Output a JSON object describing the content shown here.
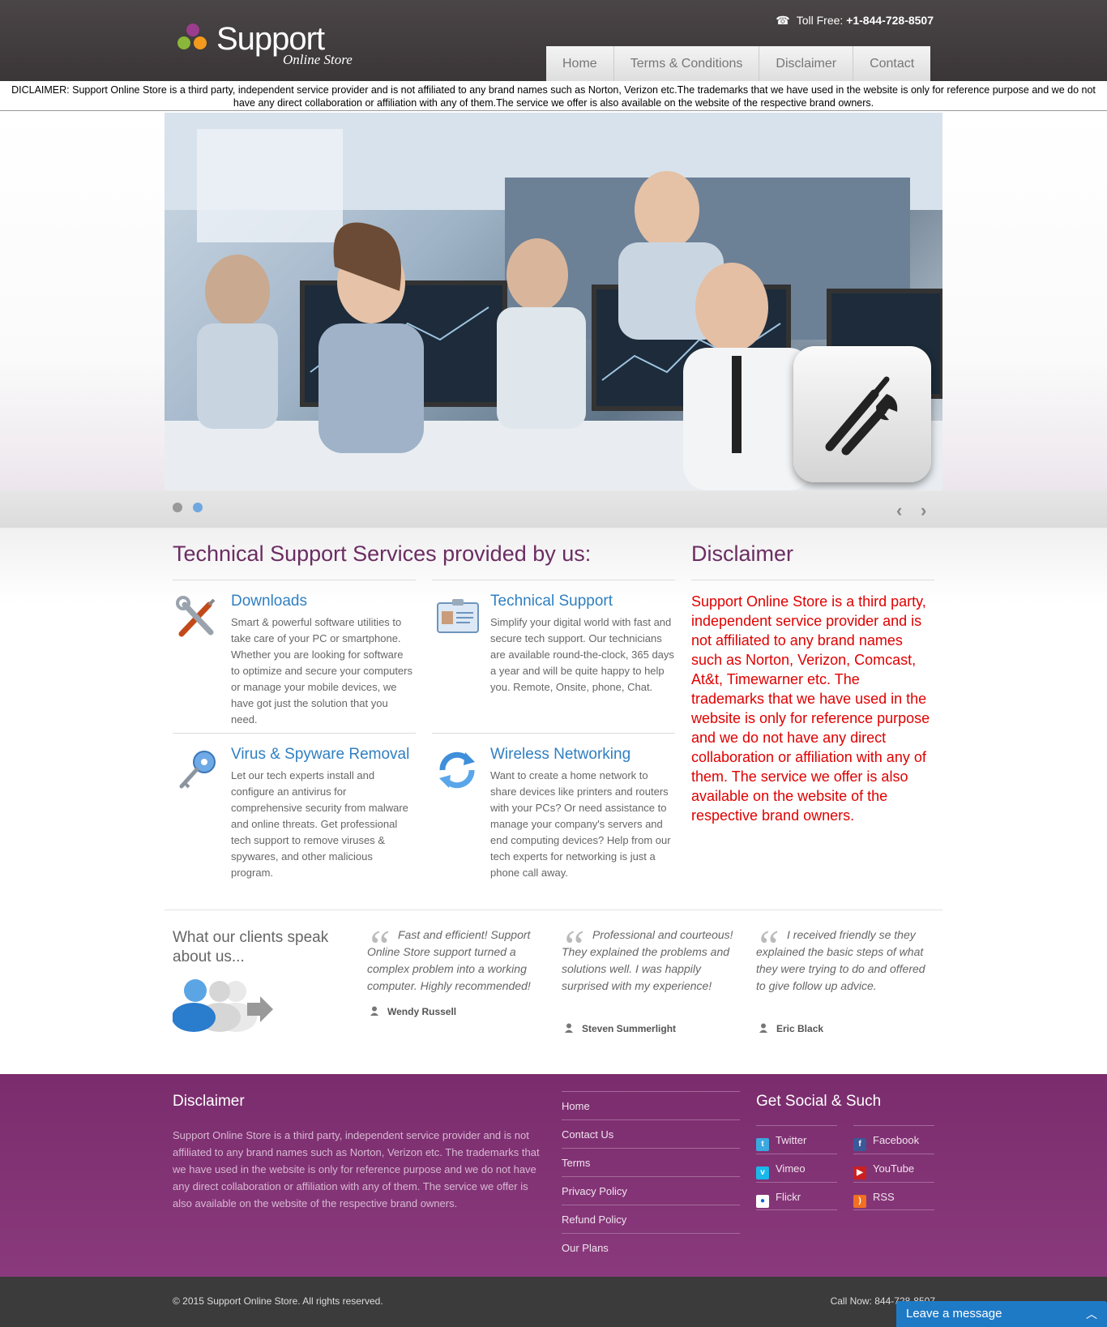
{
  "header": {
    "brand": "Support",
    "brand_sub": "Online Store",
    "toll_label": "Toll Free: ",
    "toll_number": "+1-844-728-8507",
    "nav": [
      "Home",
      "Terms & Conditions",
      "Disclaimer",
      "Contact"
    ]
  },
  "disclaimer_bar": "DICLAIMER: Support Online Store is a third party, independent service provider and is not affiliated to any brand names such as Norton, Verizon etc.The trademarks that we have used in the website is only for reference purpose and we do not have any direct collaboration or affiliation with any of them.The service we offer is also available on the website of the respective brand owners.",
  "slider": {
    "prev": "‹",
    "next": "›"
  },
  "services": {
    "title": "Technical Support Services provided by us:",
    "items": [
      {
        "title": "Downloads",
        "text": "Smart & powerful software utilities to take care of your PC or smartphone. Whether you are looking for software to optimize and secure your computers or manage your mobile devices, we have got just the solution that you need."
      },
      {
        "title": "Technical Support",
        "text": "Simplify your digital world with fast and secure tech support. Our technicians are available round-the-clock, 365 days a year and will be quite happy to help you. Remote, Onsite, phone, Chat."
      },
      {
        "title": "Virus & Spyware Removal",
        "text": "Let our tech experts install and configure an antivirus for comprehensive security from malware and online threats. Get professional tech support to remove viruses & spywares, and other malicious program."
      },
      {
        "title": "Wireless Networking",
        "text": "Want to create a home network to share devices like printers and routers with your PCs? Or need assistance to manage your company's servers and end computing devices? Help from our tech experts for networking is just a phone call away."
      }
    ]
  },
  "disclaimer": {
    "title": "Disclaimer",
    "text": "Support Online Store is a third party, independent service provider and is not affiliated to any brand names such as Norton, Verizon, Comcast, At&t, Timewarner etc. The trademarks that we have used in the website is only for reference purpose and we do not have any direct collaboration or affiliation with any of them. The service we offer is also available on the website of the respective brand owners."
  },
  "clients": {
    "title": "What our clients speak about us...",
    "quotes": [
      {
        "text": "Fast and efficient! Support Online Store support turned a complex problem into a working computer. Highly recommended!",
        "author": "Wendy Russell"
      },
      {
        "text": "Professional and courteous! They explained the problems and solutions well. I was happily surprised with my experience!",
        "author": "Steven Summerlight"
      },
      {
        "text": "I received friendly se they explained the basic steps of what they were trying to do and offered to give follow up advice.",
        "author": "Eric Black"
      }
    ]
  },
  "footer": {
    "disclaimer_title": "Disclaimer",
    "disclaimer_text": "Support Online Store is a third party, independent service provider and is not affiliated to any brand names such as Norton, Verizon etc. The trademarks that we have used in the website is only for reference purpose and we do not have any direct collaboration or affiliation with any of them. The service we offer is also available on the website of the respective brand owners.",
    "links": [
      "Home",
      "Contact Us",
      "Terms",
      "Privacy Policy",
      "Refund Policy",
      "Our Plans"
    ],
    "social_title": "Get Social & Such",
    "social": [
      {
        "label": "Twitter",
        "icon": "twitter-icon",
        "color": "#3aa9e0"
      },
      {
        "label": "Facebook",
        "icon": "facebook-icon",
        "color": "#3b5998"
      },
      {
        "label": "Vimeo",
        "icon": "vimeo-icon",
        "color": "#1ab7ea"
      },
      {
        "label": "YouTube",
        "icon": "youtube-icon",
        "color": "#cc2020"
      },
      {
        "label": "Flickr",
        "icon": "flickr-icon",
        "color": "#ffffff"
      },
      {
        "label": "RSS",
        "icon": "rss-icon",
        "color": "#f26f22"
      }
    ],
    "copyright": "© 2015 Support Online Store. All rights reserved.",
    "call_now": "Call Now: 844-728-8507"
  },
  "chat": {
    "label": "Leave a message"
  }
}
